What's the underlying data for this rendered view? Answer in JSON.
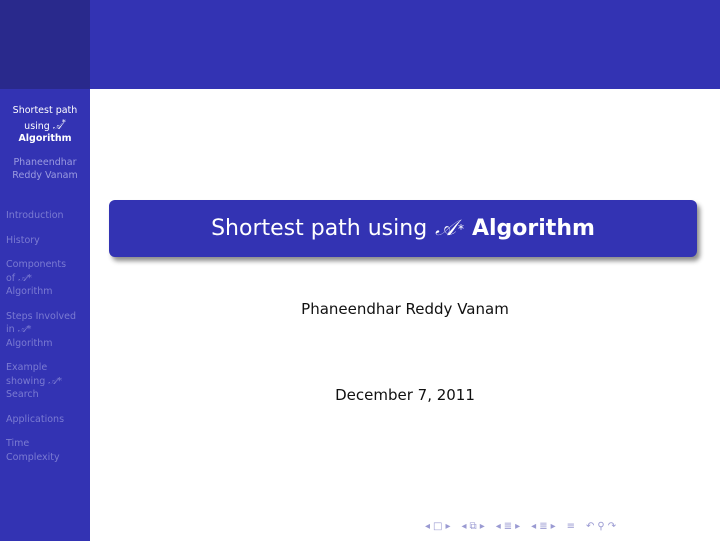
{
  "sidebar": {
    "title_line1": "Shortest path",
    "title_line2_prefix": "using ",
    "title_line2_math": "𝒜",
    "title_line2_sup": "*",
    "title_line3": "Algorithm",
    "author_line1": "Phaneendhar",
    "author_line2": "Reddy Vanam",
    "nav": [
      {
        "label": "Introduction"
      },
      {
        "label": "History"
      },
      {
        "label_a": "Components",
        "label_b": "of ",
        "math": "𝒜*",
        "label_c": "Algorithm"
      },
      {
        "label_a": "Steps Involved",
        "label_b": "in ",
        "math": "𝒜*",
        "label_c": "Algorithm"
      },
      {
        "label_a": "Example",
        "label_b": "showing ",
        "math": "𝒜*",
        "label_c": "Search"
      },
      {
        "label": "Applications"
      },
      {
        "label_a": "Time",
        "label_c": "Complexity"
      }
    ]
  },
  "slide": {
    "title_prefix": "Shortest path using",
    "title_math": "𝒜",
    "title_sup": "*",
    "title_bold": "Algorithm",
    "author": "Phaneendhar Reddy Vanam",
    "date": "December 7, 2011"
  },
  "navbar": {
    "frame_prev": "◂",
    "frame_icon": "□",
    "frame_next": "▸",
    "subsec_prev": "◂",
    "subsec_icon": "⧉",
    "subsec_next": "▸",
    "sec_prev": "◂",
    "sec_icon": "≣",
    "sec_next": "▸",
    "part_prev": "◂",
    "part_icon": "≣",
    "part_next": "▸",
    "doc_icon": "≡",
    "undo_icon": "↶",
    "search_icon": "⚲",
    "redo_icon": "↷"
  }
}
